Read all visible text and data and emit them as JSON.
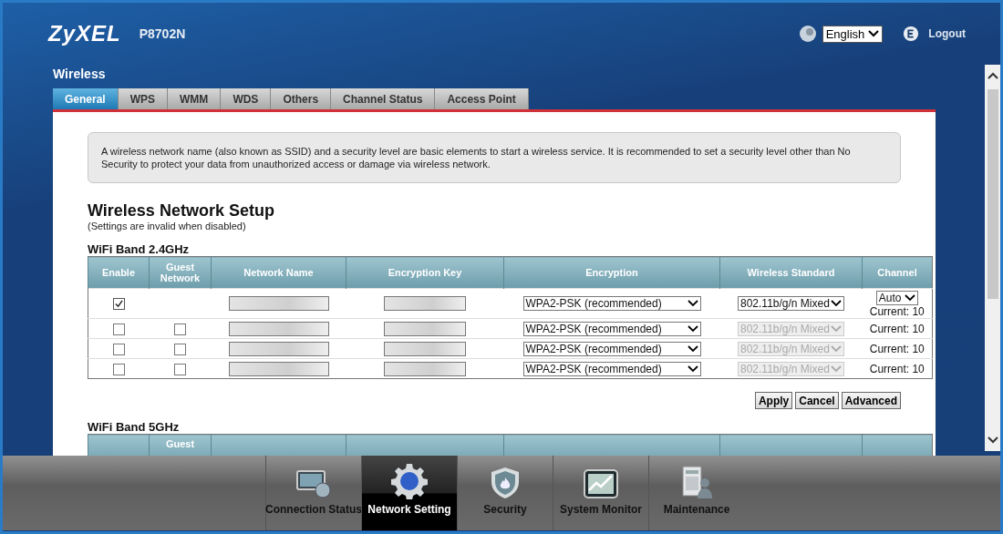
{
  "header": {
    "brand": "ZyXEL",
    "model": "P8702N",
    "language": "English",
    "logout": "Logout"
  },
  "section": "Wireless",
  "tabs": [
    {
      "label": "General",
      "selected": true
    },
    {
      "label": "WPS",
      "selected": false
    },
    {
      "label": "WMM",
      "selected": false
    },
    {
      "label": "WDS",
      "selected": false
    },
    {
      "label": "Others",
      "selected": false
    },
    {
      "label": "Channel Status",
      "selected": false
    },
    {
      "label": "Access Point",
      "selected": false
    }
  ],
  "info": "A wireless network name (also known as SSID) and a security level are basic elements to start a wireless service. It is recommended to set a security level other than No Security to protect your data from unauthorized access or damage via wireless network.",
  "title": "Wireless Network Setup",
  "subtitle": "(Settings are invalid when disabled)",
  "band_24": {
    "title": "WiFi Band 2.4GHz",
    "columns": [
      "Enable",
      "Guest Network",
      "Network Name",
      "Encryption Key",
      "Encryption",
      "Wireless Standard",
      "Channel"
    ],
    "rows": [
      {
        "enabled": true,
        "encryption": "WPA2-PSK (recommended)",
        "standard": "802.11b/g/n Mixed",
        "standard_disabled": false,
        "channel_mode": "Auto",
        "current": "Current: 10"
      },
      {
        "enabled": false,
        "guest": false,
        "encryption": "WPA2-PSK (recommended)",
        "standard": "802.11b/g/n Mixed",
        "standard_disabled": true,
        "current": "Current: 10"
      },
      {
        "enabled": false,
        "guest": false,
        "encryption": "WPA2-PSK (recommended)",
        "standard": "802.11b/g/n Mixed",
        "standard_disabled": true,
        "current": "Current: 10"
      },
      {
        "enabled": false,
        "guest": false,
        "encryption": "WPA2-PSK (recommended)",
        "standard": "802.11b/g/n Mixed",
        "standard_disabled": true,
        "current": "Current: 10"
      }
    ]
  },
  "buttons": [
    "Apply",
    "Cancel",
    "Advanced"
  ],
  "band_5": {
    "title": "WiFi Band 5GHz",
    "column_2": "Guest"
  },
  "dock": [
    {
      "label": "Connection Status",
      "kind": "monitor",
      "selected": false
    },
    {
      "label": "Network Setting",
      "kind": "gear",
      "selected": true
    },
    {
      "label": "Security",
      "kind": "shield",
      "selected": false
    },
    {
      "label": "System Monitor",
      "kind": "chart",
      "selected": false
    },
    {
      "label": "Maintenance",
      "kind": "cabinet",
      "selected": false
    }
  ]
}
